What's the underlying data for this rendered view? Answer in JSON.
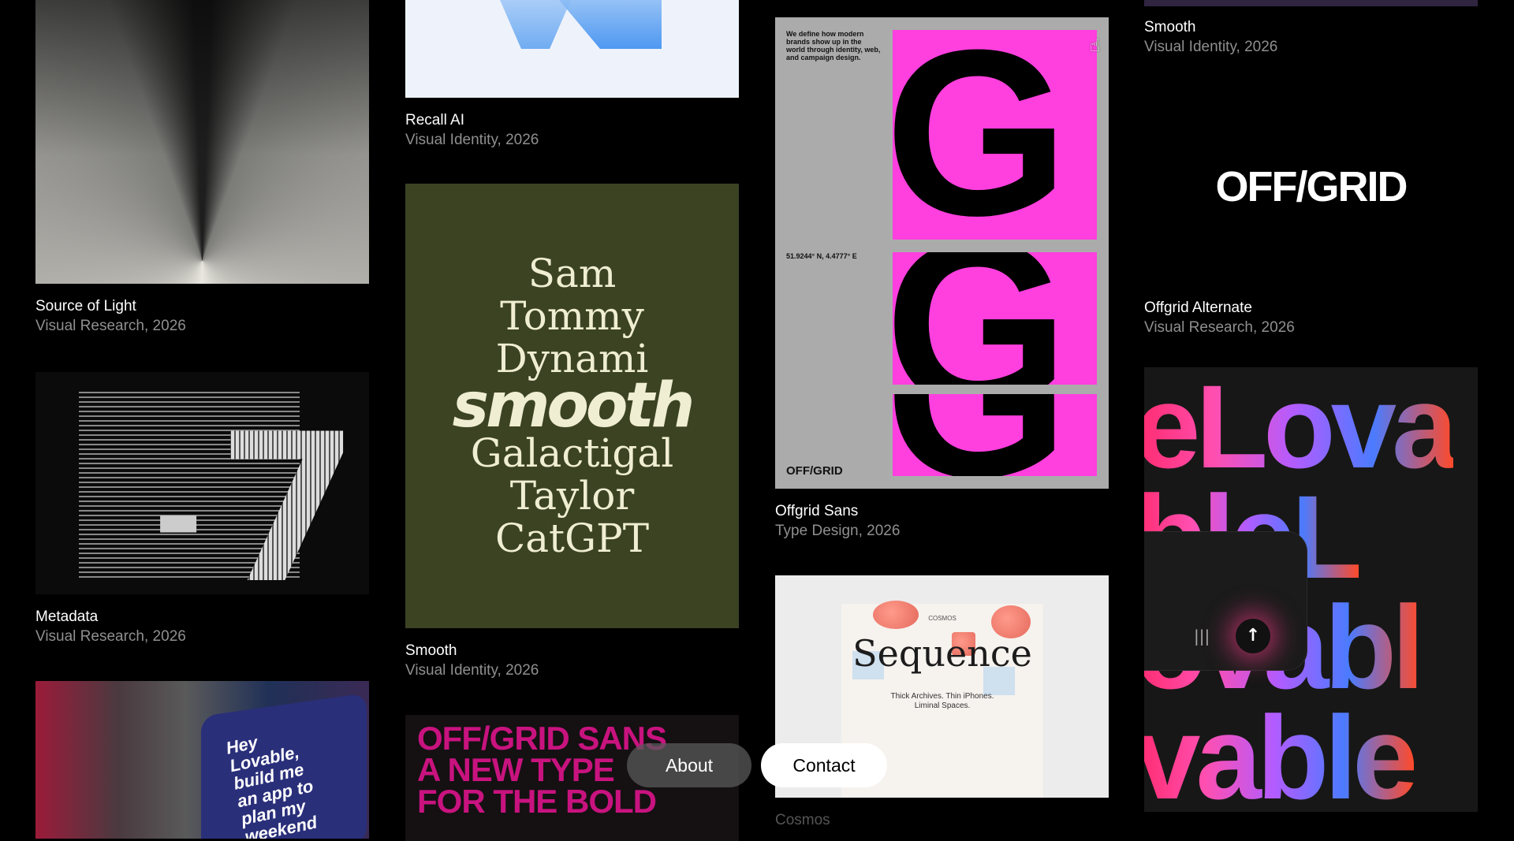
{
  "projects": [
    {
      "title": "Source of Light",
      "subtitle": "Visual Research, 2026"
    },
    {
      "title": "Metadata",
      "subtitle": "Visual Research, 2026"
    },
    {
      "title": "Recall AI",
      "subtitle": "Visual Identity, 2026"
    },
    {
      "title": "Smooth",
      "subtitle": "Visual Identity, 2026"
    },
    {
      "title": "Offgrid Sans",
      "subtitle": "Type Design, 2026"
    },
    {
      "title": "Cosmos",
      "subtitle": ""
    },
    {
      "title": "Smooth",
      "subtitle": "Visual Identity, 2026"
    },
    {
      "title": "Offgrid Alternate",
      "subtitle": "Visual Research, 2026"
    }
  ],
  "smooth_poster": {
    "words": [
      "Sam",
      "Tommy",
      "Dynami",
      "smooth",
      "Galactigal",
      "Taylor",
      "CatGPT"
    ]
  },
  "offgrid_sans_poster": {
    "blurb": "We define how modern brands show up in the world through identity, web, and campaign design.",
    "coordinates": "51.9244° N, 4.4777° E",
    "logo": "OFF/GRID",
    "glyph": "G"
  },
  "offgrid_alternate_logo": "OFF/GRID",
  "offgrid_type_poster": [
    "OFF/GRID SANS",
    "A NEW TYPE",
    "FOR THE BOLD"
  ],
  "subway_ad": "Hey Lovable, build me an app to plan my weekend holiday",
  "cosmos_poster": {
    "brand": "COSMOS",
    "word": "Sequence",
    "line1": "Thick Archives. Thin iPhones.",
    "line2": "Liminal Spaces."
  },
  "lovable_rows": [
    "eLova",
    "bleL",
    "ovabl",
    "vable"
  ],
  "nav": {
    "about": "About",
    "contact": "Contact"
  },
  "colors": {
    "background": "#000000",
    "accent_pink": "#ff3fde",
    "olive": "#3b4323"
  }
}
